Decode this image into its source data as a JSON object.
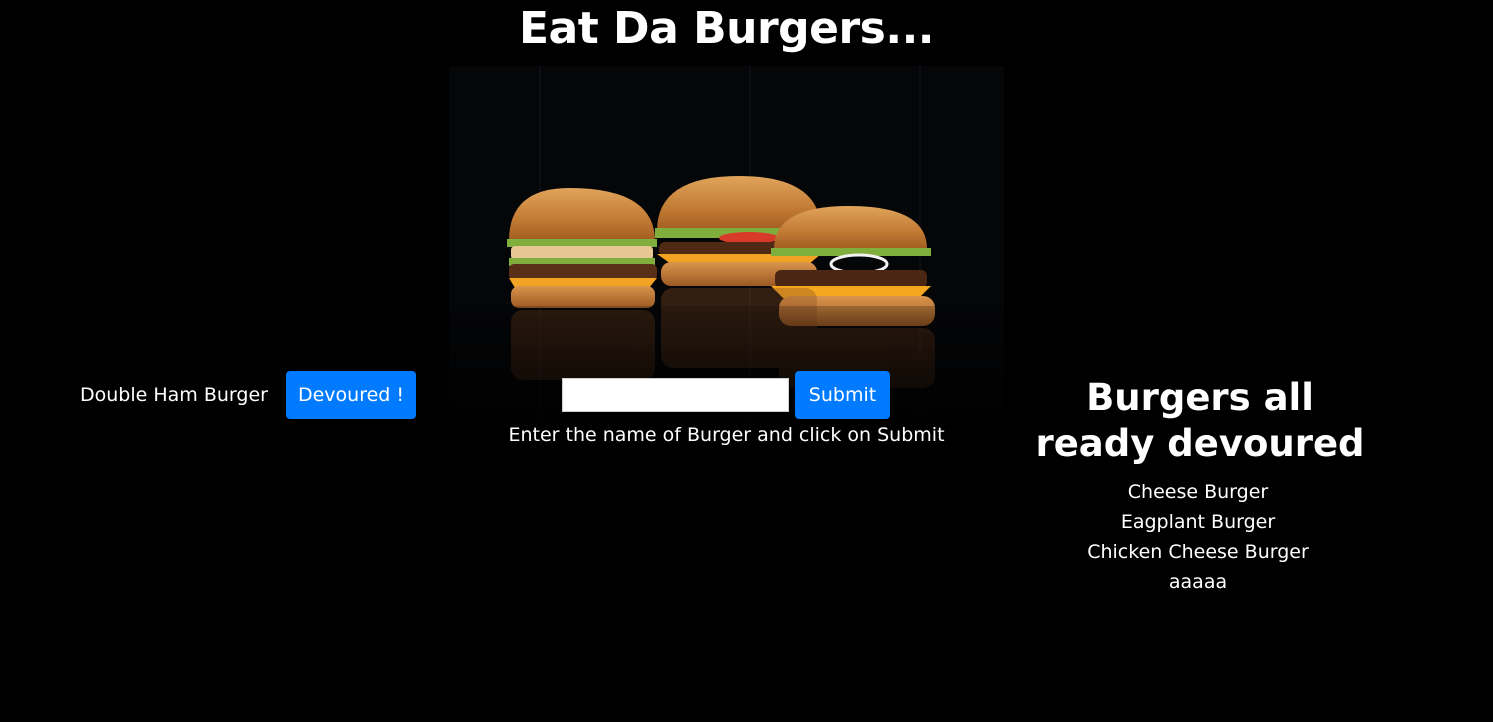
{
  "header": {
    "title": "Eat Da Burgers..."
  },
  "hero_image": {
    "icon": "burgers-photo"
  },
  "undevoured": {
    "items": [
      {
        "name": "Double Ham Burger",
        "button_label": "Devoured !"
      }
    ]
  },
  "form": {
    "input_value": "",
    "submit_label": "Submit",
    "help_text": "Enter the name of Burger and click on Submit"
  },
  "devoured": {
    "heading": "Burgers all ready devoured",
    "items": [
      "Cheese Burger",
      "Eagplant Burger",
      "Chicken Cheese Burger",
      "aaaaa"
    ]
  },
  "colors": {
    "background": "#000000",
    "button": "#007bff",
    "text": "#ffffff"
  }
}
